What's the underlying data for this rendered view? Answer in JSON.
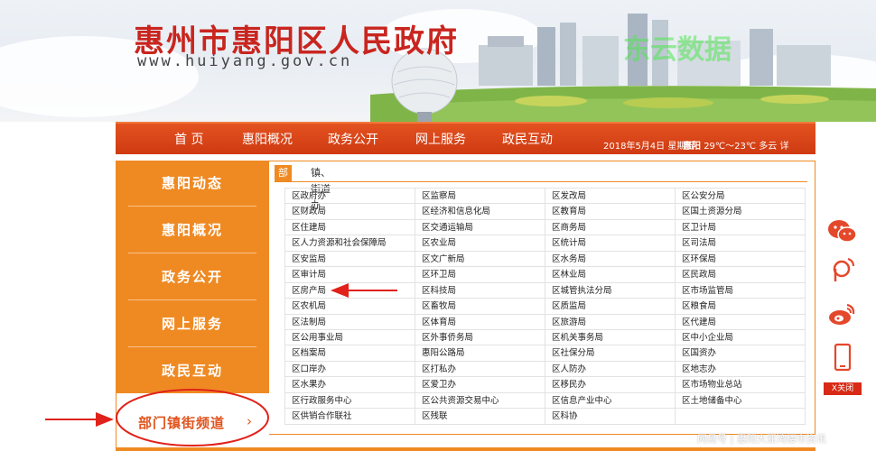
{
  "site": {
    "title": "惠州市惠阳区人民政府",
    "url": "www.huiyang.gov.cn",
    "watermark_top": "东云数据"
  },
  "nav": {
    "items": [
      "首 页",
      "惠阳概况",
      "政务公开",
      "网上服务",
      "政民互动"
    ],
    "date": "2018年5月4日 星期五",
    "weather_place": "惠阳",
    "weather": "29℃～23℃ 多云 详"
  },
  "left_menu": {
    "items": [
      "惠阳动态",
      "惠阳概况",
      "政务公开",
      "网上服务",
      "政民互动"
    ],
    "active": "部门镇街频道",
    "active_chevron": "›"
  },
  "tabs": [
    "部门",
    "镇、街道办"
  ],
  "departments": [
    [
      "区政府办",
      "区监察局",
      "区发改局",
      "区公安分局"
    ],
    [
      "区财政局",
      "区经济和信息化局",
      "区教育局",
      "区国土资源分局"
    ],
    [
      "区住建局",
      "区交通运输局",
      "区商务局",
      "区卫计局"
    ],
    [
      "区人力资源和社会保障局",
      "区农业局",
      "区统计局",
      "区司法局"
    ],
    [
      "区安监局",
      "区文广新局",
      "区水务局",
      "区环保局"
    ],
    [
      "区审计局",
      "区环卫局",
      "区林业局",
      "区民政局"
    ],
    [
      "区房产局",
      "区科技局",
      "区城管执法分局",
      "区市场监管局"
    ],
    [
      "区农机局",
      "区畜牧局",
      "区质监局",
      "区粮食局"
    ],
    [
      "区法制局",
      "区体育局",
      "区旅游局",
      "区代建局"
    ],
    [
      "区公用事业局",
      "区外事侨务局",
      "区机关事务局",
      "区中小企业局"
    ],
    [
      "区档案局",
      "惠阳公路局",
      "区社保分局",
      "区国资办"
    ],
    [
      "区口岸办",
      "区打私办",
      "区人防办",
      "区地志办"
    ],
    [
      "区水果办",
      "区爱卫办",
      "区移民办",
      "区市场物业总站"
    ],
    [
      "区行政服务中心",
      "区公共资源交易中心",
      "区信息产业中心",
      "区土地储备中心"
    ],
    [
      "区供销合作联社",
      "区残联",
      "区科协",
      ""
    ]
  ],
  "side": {
    "icons": [
      "wechat-icon",
      "weibo-p-icon",
      "weibo-icon",
      "mobile-icon"
    ],
    "close_label": "X关闭"
  },
  "watermark_bottom": "网易号 | 惠阳大亚湾楼市资讯",
  "colors": {
    "accent": "#ef8a23",
    "nav_red": "#d8441a",
    "title_red": "#c9251f",
    "annotation_red": "#e0221a"
  }
}
